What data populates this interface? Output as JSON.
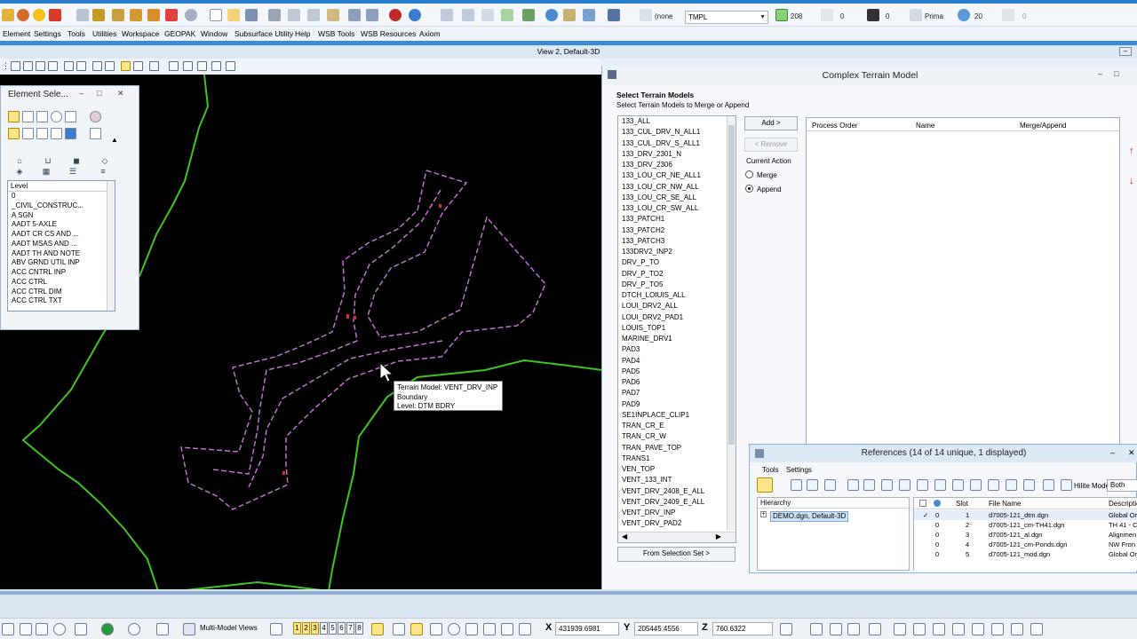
{
  "toolbar": {
    "color_field": "(none",
    "template_field": "TMPL",
    "weight_value": "208",
    "linestyle_value": "0",
    "lineweight_value": "0",
    "priority_label": "Prima",
    "transparency_value": "20",
    "extra_value": "0"
  },
  "menubar": {
    "items": [
      "Element",
      "Settings",
      "Tools",
      "Utilities",
      "Workspace",
      "GEOPAK",
      "Window",
      "Subsurface Utility",
      "Help",
      "WSB Tools",
      "WSB Resources",
      "Axiom"
    ]
  },
  "view": {
    "title": "View 2, Default-3D"
  },
  "tooltip": {
    "line1": "Terrain Model: VENT_DRV_INP",
    "line2": "Boundary",
    "line3": "Level: DTM BDRY"
  },
  "element_selection": {
    "title": "Element Sele...",
    "level_header": "Level",
    "levels": [
      "0",
      "_CIVIL_CONSTRUC...",
      "A SGN",
      "AADT 5-AXLE",
      "AADT CR CS AND ...",
      "AADT MSAS AND ...",
      "AADT TH AND NOTE",
      "ABV GRND UTIL INP",
      "ACC CNTRL INP",
      "ACC CTRL",
      "ACC CTRL DIM",
      "ACC CTRL TXT"
    ]
  },
  "ctm": {
    "title": "Complex Terrain Model",
    "heading": "Select Terrain Models",
    "subheading": "Select Terrain Models to Merge or Append",
    "terrain_models": [
      "133_ALL",
      "133_CUL_DRV_N_ALL1",
      "133_CUL_DRV_S_ALL1",
      "133_DRV_2301_N",
      "133_DRV_2306",
      "133_LOU_CR_NE_ALL1",
      "133_LOU_CR_NW_ALL",
      "133_LOU_CR_SE_ALL",
      "133_LOU_CR_SW_ALL",
      "133_PATCH1",
      "133_PATCH2",
      "133_PATCH3",
      "133DRV2_INP2",
      "DRV_P_TO",
      "DRV_P_TO2",
      "DRV_P_TO5",
      "DTCH_LOIUIS_ALL",
      "LOUI_DRV2_ALL",
      "LOUI_DRV2_PAD1",
      "LOUIS_TOP1",
      "MARINE_DRV1",
      "PAD3",
      "PAD4",
      "PAD5",
      "PAD6",
      "PAD7",
      "PAD9",
      "SE1INPLACE_CLIP1",
      "TRAN_CR_E",
      "TRAN_CR_W",
      "TRAN_PAVE_TOP",
      "TRANS1",
      "VEN_TOP",
      "VENT_133_INT",
      "VENT_DRV_2408_E_ALL",
      "VENT_DRV_2409_E_ALL",
      "VENT_DRV_INP",
      "VENT_DRV_PAD2"
    ],
    "add_label": "Add >",
    "remove_label": "< Remove",
    "current_action_label": "Current Action",
    "merge_label": "Merge",
    "append_label": "Append",
    "selected_action": "append",
    "from_selection_label": "From Selection Set >",
    "columns": [
      "Process Order",
      "Name",
      "Merge/Append"
    ]
  },
  "references": {
    "title": "References (14 of 14 unique, 1 displayed)",
    "menu": [
      "Tools",
      "Settings"
    ],
    "hilite_label": "Hilite Mode:",
    "hilite_value": "Both",
    "hierarchy_header": "Hierarchy",
    "hierarchy_item": "DEMO.dgn, Default-3D",
    "columns": {
      "slot": "Slot",
      "file_name": "File Name",
      "description": "Descriptio"
    },
    "rows": [
      {
        "check": "✓",
        "flag": "0",
        "slot": "1",
        "file": "d7005-121_dtm.dgn",
        "desc": "Global Or"
      },
      {
        "check": "",
        "flag": "0",
        "slot": "2",
        "file": "d7005-121_cm-TH41.dgn",
        "desc": "TH 41 - C"
      },
      {
        "check": "",
        "flag": "0",
        "slot": "3",
        "file": "d7005-121_al.dgn",
        "desc": "Alignmen"
      },
      {
        "check": "",
        "flag": "0",
        "slot": "4",
        "file": "d7005-121_cm-Ponds.dgn",
        "desc": "NW Fron"
      },
      {
        "check": "",
        "flag": "0",
        "slot": "5",
        "file": "d7005-121_mod.dgn",
        "desc": "Global Or"
      }
    ]
  },
  "statusbar": {
    "view_group": "Multi-Model Views",
    "view_numbers": [
      "1",
      "2",
      "3",
      "4",
      "5",
      "6",
      "7",
      "8"
    ],
    "x_label": "X",
    "x_value": "431939.6981",
    "y_label": "Y",
    "y_value": "205445.4556",
    "z_label": "Z",
    "z_value": "760.6322"
  },
  "colors": {
    "green_line": "#3ec41e",
    "purple_line": "#c070d0",
    "accent_blue": "#2a7fd1"
  }
}
